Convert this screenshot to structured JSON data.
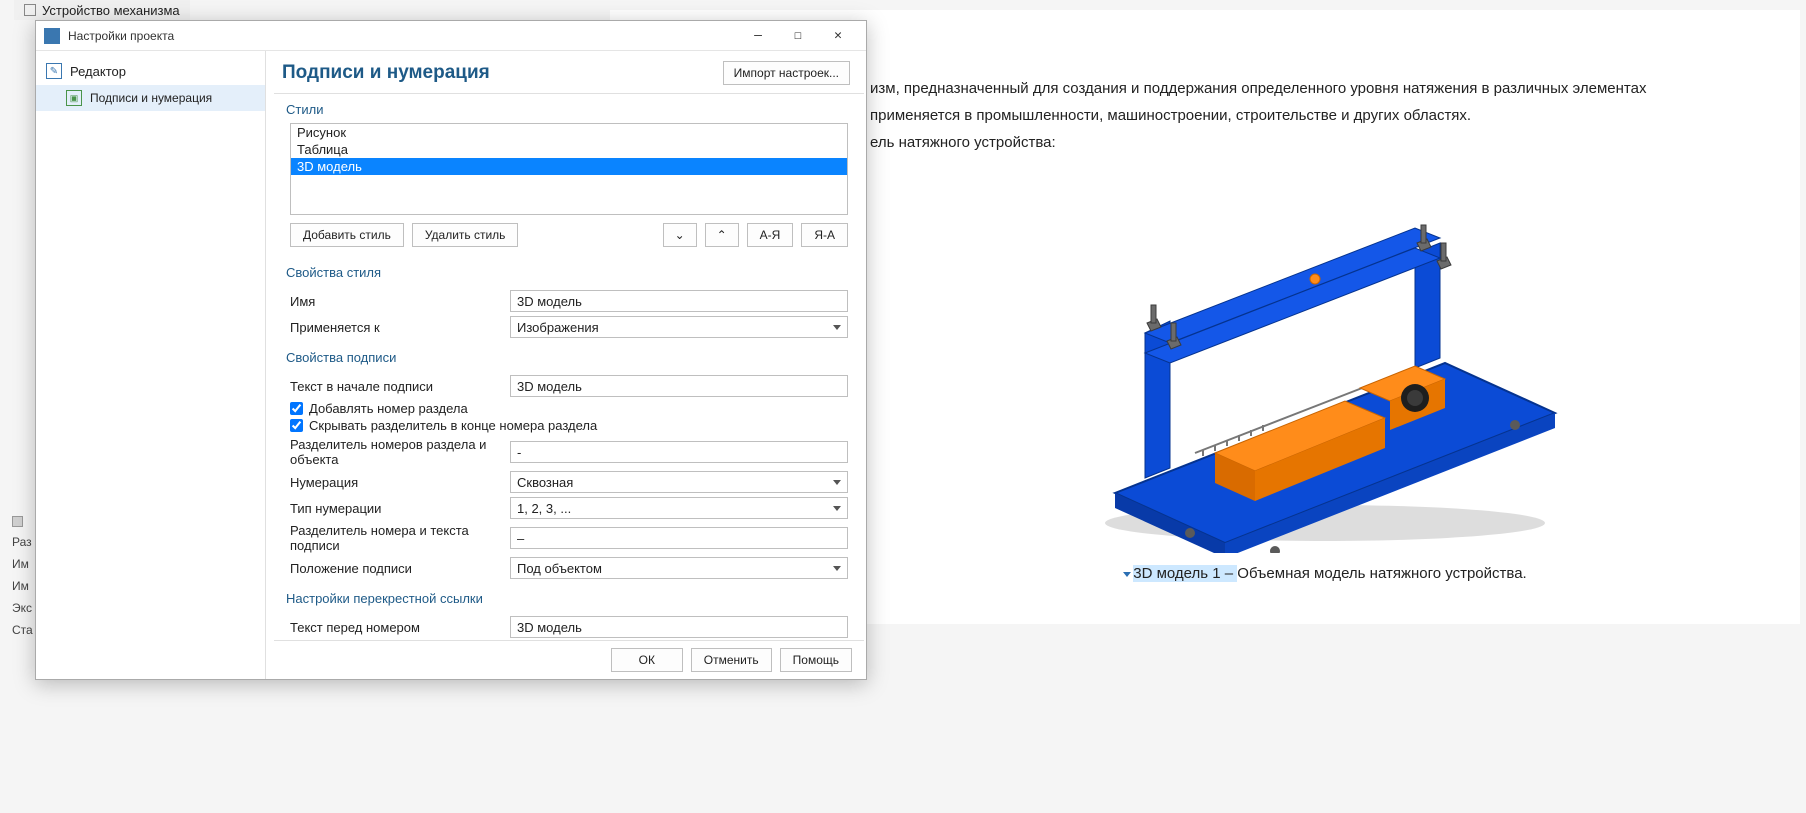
{
  "bg": {
    "tab_title": "Устройство механизма",
    "sidebar_items": [
      "Раз",
      "Им",
      "Им",
      "Экс",
      "Ста"
    ],
    "paragraph1_tail": "изм, предназначенный для создания и поддержания определенного уровня натяжения в различных элементах",
    "paragraph2_tail": "применяется в промышленности, машиностроении, строительстве и других областях.",
    "paragraph3_tail": "ель натяжного устройства:",
    "caption_prefix": "3D модель 1 – ",
    "caption_text": "Объемная модель натяжного устройства."
  },
  "dialog": {
    "title": "Настройки проекта",
    "nav": {
      "root": "Редактор",
      "child": "Подписи и нумерация"
    },
    "heading": "Подписи и нумерация",
    "import_btn": "Импорт настроек...",
    "sections": {
      "styles_head": "Стили",
      "style_props_head": "Свойства стиля",
      "caption_props_head": "Свойства подписи",
      "xref_head": "Настройки перекрестной ссылки"
    },
    "styles_list": [
      "Рисунок",
      "Таблица",
      "3D модель"
    ],
    "styles_selected_index": 2,
    "styles_toolbar": {
      "add": "Добавить стиль",
      "del": "Удалить стиль",
      "az": "А-Я",
      "za": "Я-А"
    },
    "style_props": {
      "name_label": "Имя",
      "name_value": "3D модель",
      "applies_label": "Применяется к",
      "applies_value": "Изображения"
    },
    "caption_props": {
      "prefix_label": "Текст в начале подписи",
      "prefix_value": "3D модель",
      "add_chapter": "Добавлять номер раздела",
      "hide_sep": "Скрывать разделитель в конце номера раздела",
      "sep_chap_obj_label": "Разделитель номеров раздела и объекта",
      "sep_chap_obj_value": "-",
      "numbering_label": "Нумерация",
      "numbering_value": "Сквозная",
      "num_type_label": "Тип нумерации",
      "num_type_value": "1, 2, 3, ...",
      "sep_num_text_label": "Разделитель номера и текста подписи",
      "sep_num_text_value": "–",
      "position_label": "Положение подписи",
      "position_value": "Под объектом"
    },
    "xref": {
      "before_num_label": "Текст перед номером",
      "before_num_value": "3D модель"
    },
    "footer": {
      "ok": "ОК",
      "cancel": "Отменить",
      "help": "Помощь"
    }
  }
}
